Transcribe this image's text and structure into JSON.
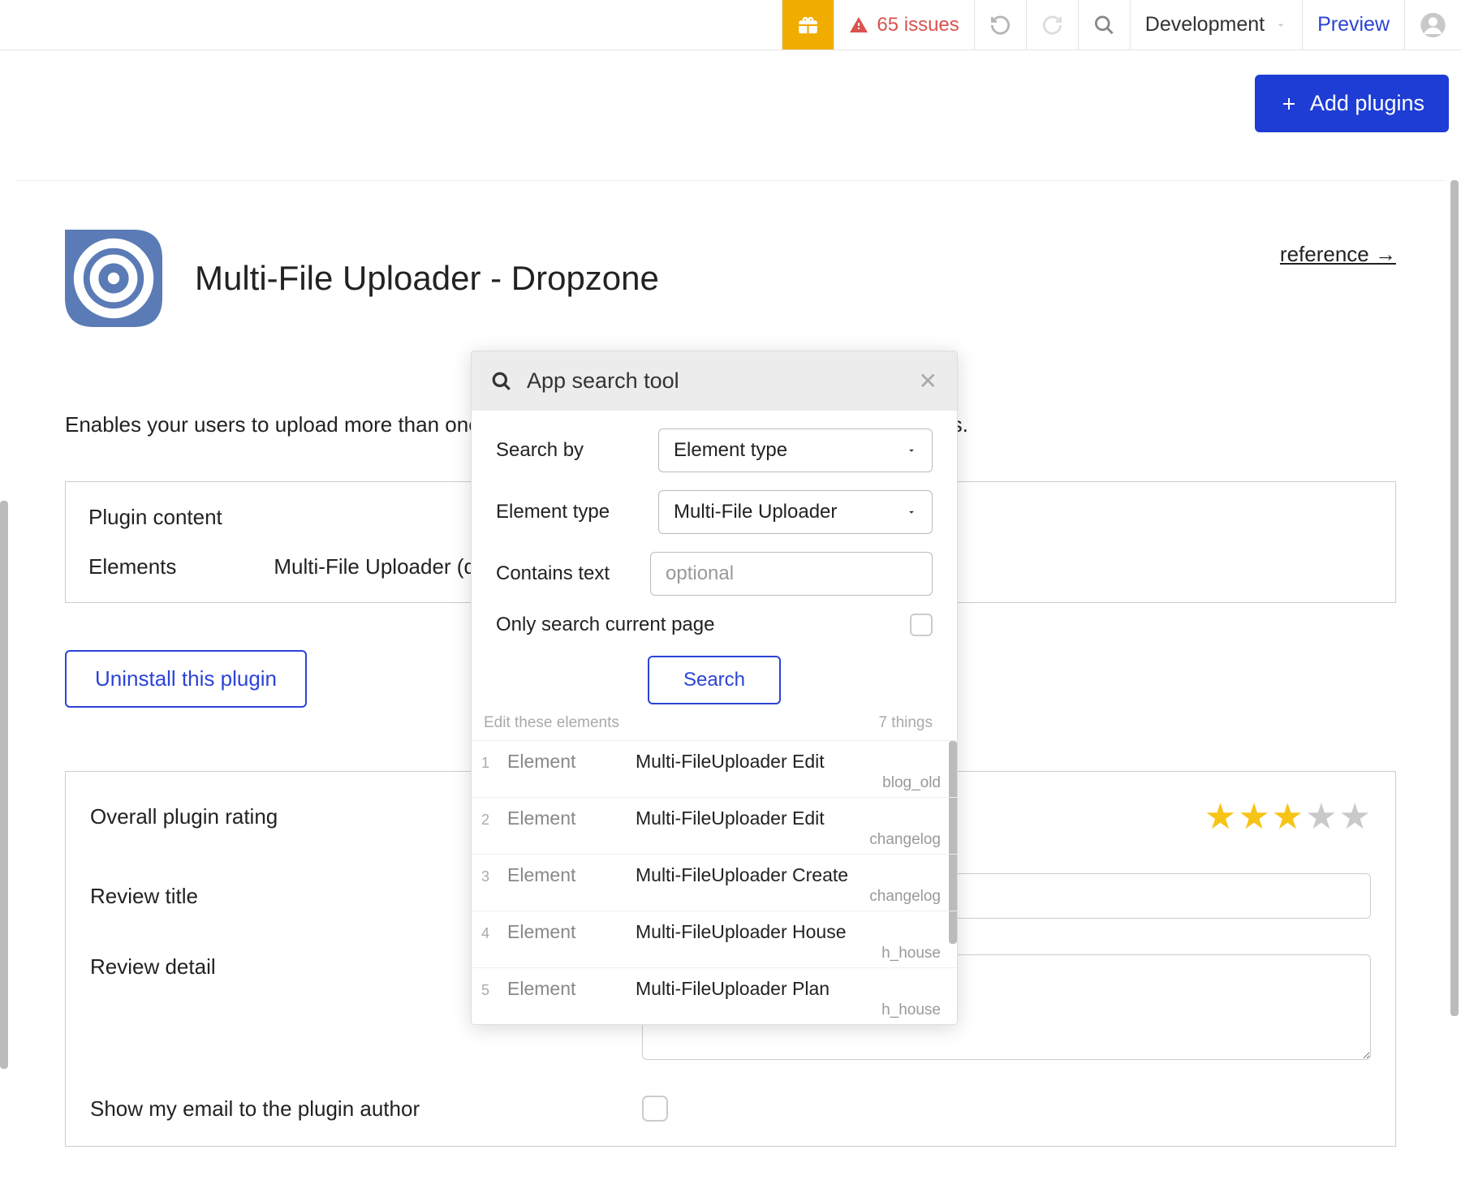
{
  "topbar": {
    "issues": "65 issues",
    "env": "Development",
    "preview": "Preview"
  },
  "subheader": {
    "add_plugins": "Add plugins"
  },
  "plugin": {
    "title": "Multi-File Uploader - Dropzone",
    "reference": "reference →",
    "description": "Enables your users to upload more than one image at the same time, drag and dropping images.",
    "content_title": "Plugin content",
    "elements_label": "Elements",
    "elements_value": "Multi-File Uploader (data source)",
    "uninstall": "Uninstall this plugin"
  },
  "review": {
    "rating_label": "Overall plugin rating",
    "stars_filled": 3,
    "title_label": "Review title",
    "detail_label": "Review detail",
    "email_label": "Show my email to the plugin author"
  },
  "modal": {
    "title": "App search tool",
    "search_by_label": "Search by",
    "search_by_value": "Element type",
    "element_type_label": "Element type",
    "element_type_value": "Multi-File Uploader",
    "contains_label": "Contains text",
    "contains_placeholder": "optional",
    "only_current": "Only search current page",
    "search_btn": "Search",
    "edit_label": "Edit these elements",
    "things_count": "7 things",
    "results": [
      {
        "n": "1",
        "type": "Element",
        "name": "Multi-FileUploader Edit",
        "page": "blog_old"
      },
      {
        "n": "2",
        "type": "Element",
        "name": "Multi-FileUploader Edit",
        "page": "changelog"
      },
      {
        "n": "3",
        "type": "Element",
        "name": "Multi-FileUploader Create",
        "page": "changelog"
      },
      {
        "n": "4",
        "type": "Element",
        "name": "Multi-FileUploader House",
        "page": "h_house"
      },
      {
        "n": "5",
        "type": "Element",
        "name": "Multi-FileUploader Plan",
        "page": "h_house"
      }
    ]
  }
}
